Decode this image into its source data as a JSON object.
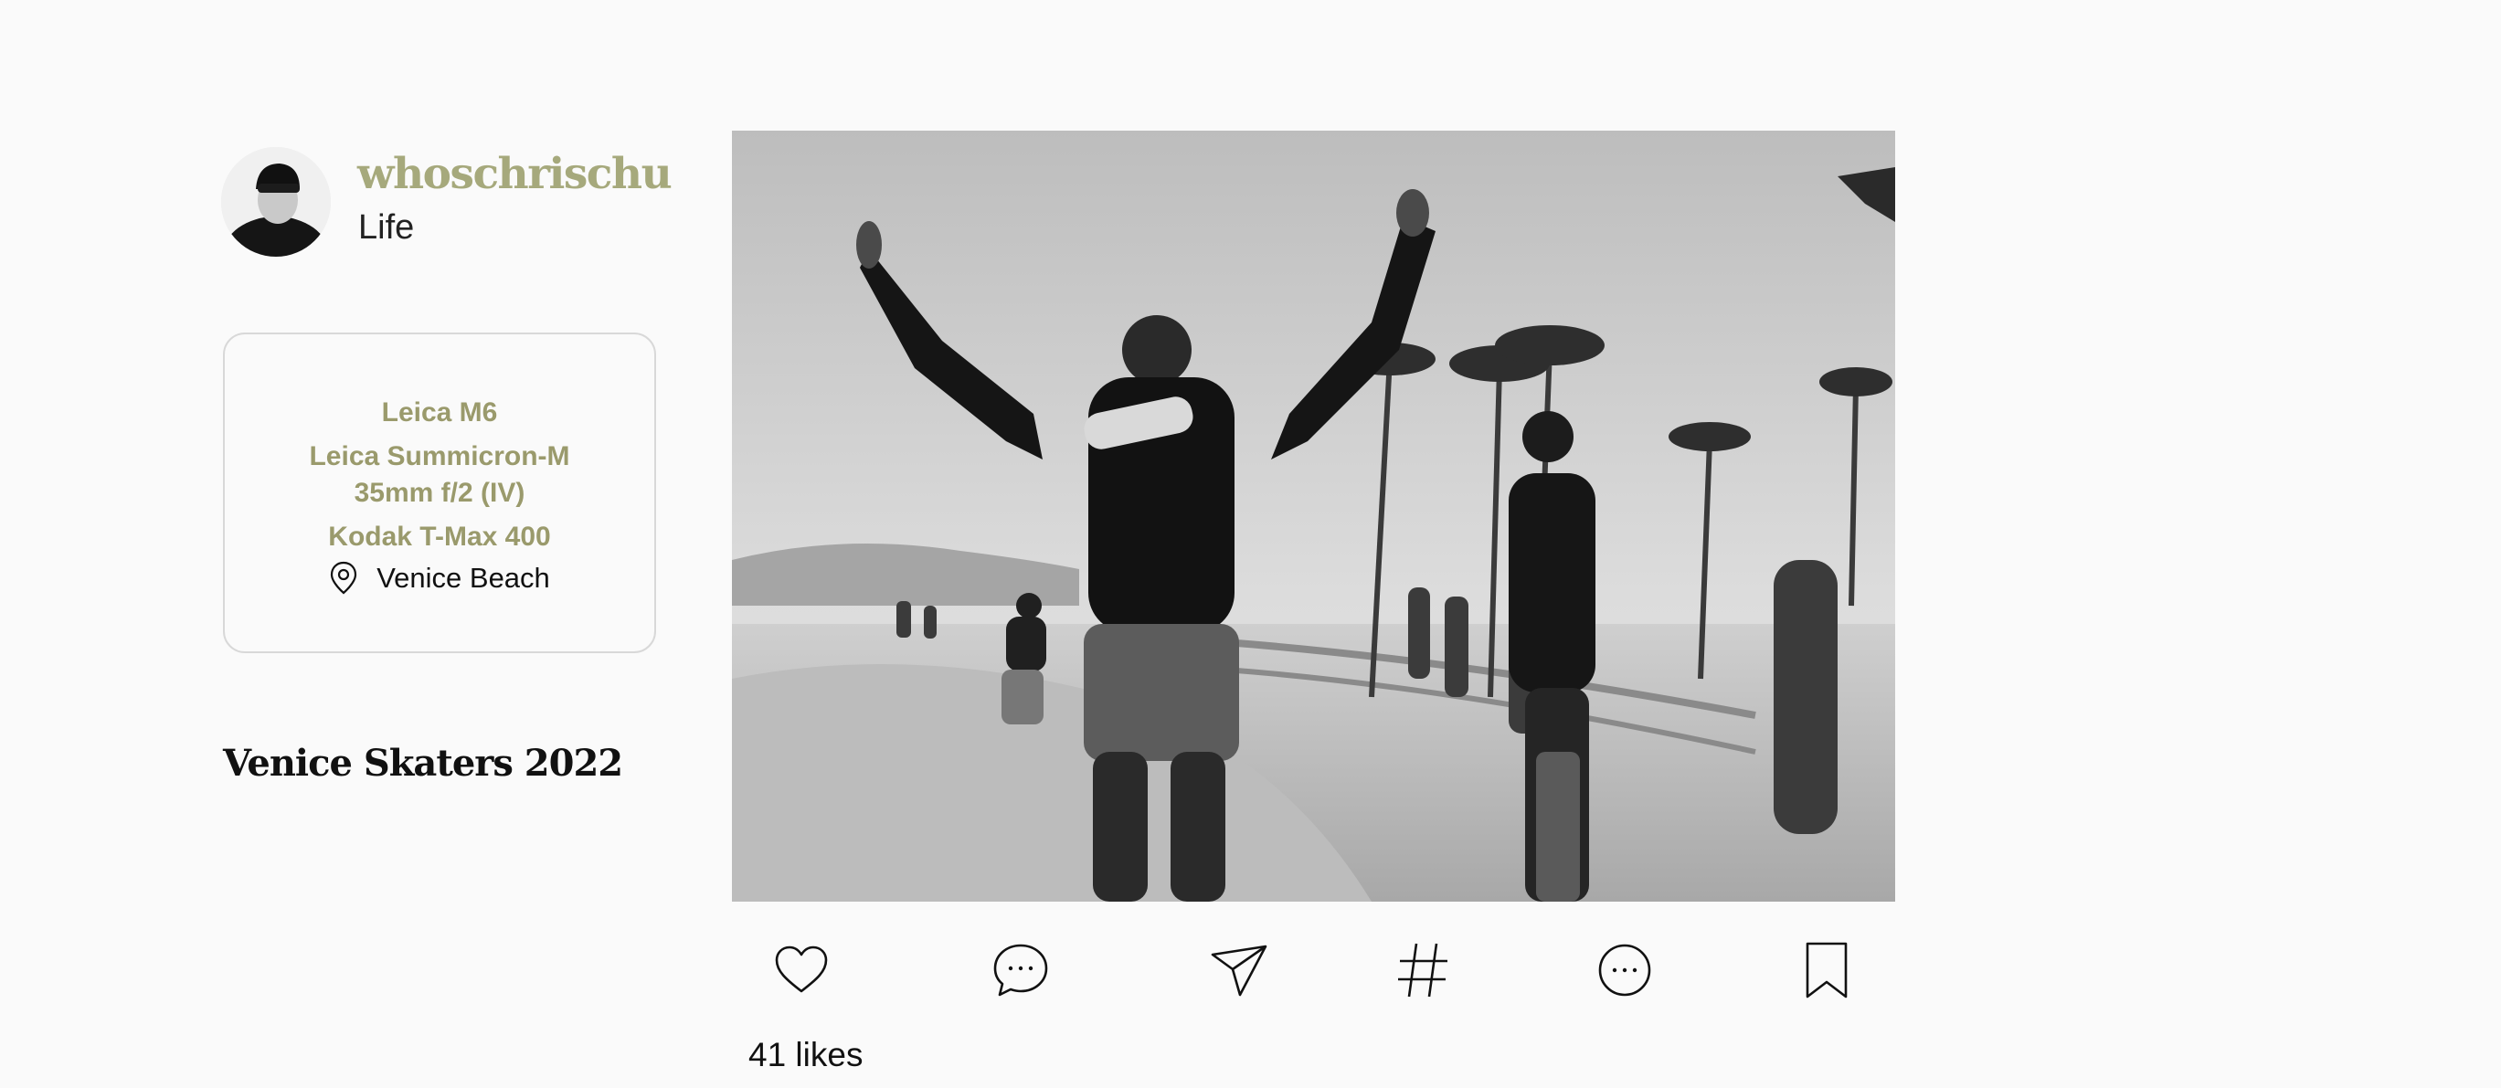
{
  "profile": {
    "username": "whoschrischu",
    "category": "Life"
  },
  "gear": {
    "camera": "Leica M6",
    "lens": "Leica Summicron-M 35mm f/2 (IV)",
    "film": "Kodak T-Max 400",
    "location": "Venice Beach",
    "location_icon": "map-pin-icon"
  },
  "post": {
    "title": "Venice Skaters 2022",
    "photo_subject": "black-and-white skate park photo",
    "likes": "41 likes"
  },
  "actions": [
    {
      "name": "like",
      "icon": "heart-icon"
    },
    {
      "name": "comment",
      "icon": "comment-bubble-icon"
    },
    {
      "name": "share",
      "icon": "paper-plane-icon"
    },
    {
      "name": "tags",
      "icon": "hashtag-icon"
    },
    {
      "name": "more",
      "icon": "more-options-icon"
    },
    {
      "name": "save",
      "icon": "bookmark-icon"
    }
  ],
  "colors": {
    "accent": "#a6a97c",
    "gear_text": "#9a9a6c",
    "background": "#fafafa",
    "text": "#111111"
  }
}
